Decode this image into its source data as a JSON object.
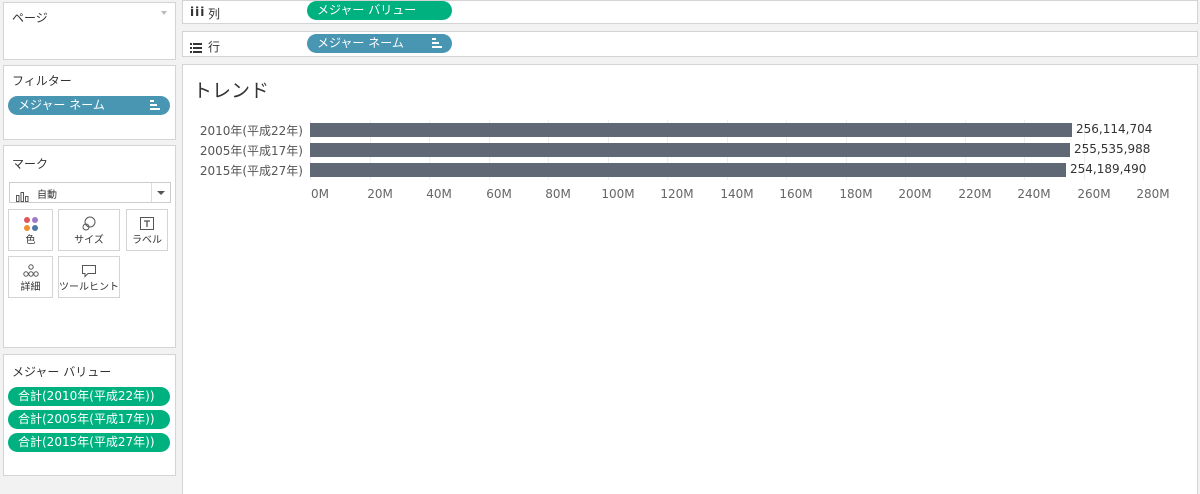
{
  "pages": {
    "title": "ページ"
  },
  "columns_shelf": {
    "label": "列",
    "pill": "メジャー バリュー"
  },
  "rows_shelf": {
    "label": "行",
    "pill": "メジャー ネーム"
  },
  "filters": {
    "title": "フィルター",
    "pill": "メジャー ネーム"
  },
  "marks": {
    "title": "マーク",
    "type_select": "自動",
    "buttons": {
      "color": "色",
      "size": "サイズ",
      "label": "ラベル",
      "detail": "詳細",
      "tooltip": "ツールヒント"
    }
  },
  "measure_values": {
    "title": "メジャー バリュー",
    "pills": [
      "合計(2010年(平成22年))",
      "合計(2005年(平成17年))",
      "合計(2015年(平成27年))"
    ]
  },
  "colors": {
    "green_pill": "#00b180",
    "blue_pill": "#4996b2",
    "bar": "#5f6874"
  },
  "chart_data": {
    "type": "bar",
    "orientation": "horizontal",
    "title": "トレンド",
    "categories": [
      "2010年(平成22年)",
      "2005年(平成17年)",
      "2015年(平成27年)"
    ],
    "values": [
      256114704,
      255535988,
      254189490
    ],
    "value_labels": [
      "256,114,704",
      "255,535,988",
      "254,189,490"
    ],
    "xlim": [
      0,
      280000000
    ],
    "x_ticks": [
      "0M",
      "20M",
      "40M",
      "60M",
      "80M",
      "100M",
      "120M",
      "140M",
      "160M",
      "180M",
      "200M",
      "220M",
      "240M",
      "260M",
      "280M"
    ],
    "grid": true
  }
}
